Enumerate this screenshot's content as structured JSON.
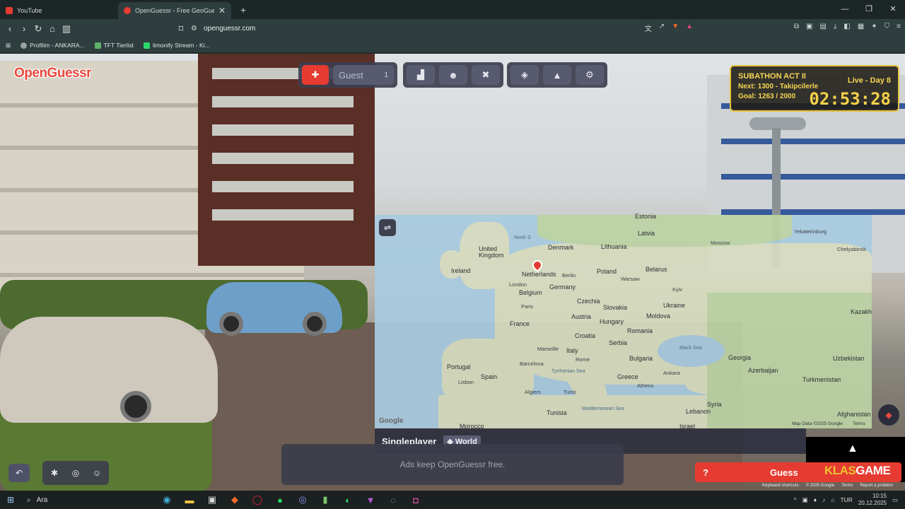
{
  "browser": {
    "tabs": [
      {
        "label": "YouTube",
        "active": false,
        "fav_color": "#e53b31"
      },
      {
        "label": "OpenGuessr - Free GeoGuessr",
        "active": true,
        "fav_color": "#e53b31"
      }
    ],
    "new_tab_icon": "plus-icon",
    "window_controls": [
      "minimize-icon",
      "restore-icon",
      "close-icon"
    ],
    "url": "openguessr.com",
    "bookmarks": [
      {
        "label": "Profilim - ANKARA...",
        "color": "#9aa0a0"
      },
      {
        "label": "TFT Tierlist",
        "color": "#5fb36a"
      },
      {
        "label": "limonify Stream - Ki...",
        "color": "#2bd96b"
      }
    ]
  },
  "game": {
    "logo": "OpenGuessr",
    "guest": {
      "placeholder": "Guest",
      "count": "1"
    },
    "subathon": {
      "title": "SUBATHON ACT II",
      "day": "Live - Day 8",
      "next": "Next: 1300 - Takipcilerle",
      "goal": "Goal: 1263 / 2000",
      "timer": "02:53:28"
    },
    "map": {
      "countries": [
        "United Kingdom",
        "Ireland",
        "Denmark",
        "Netherlands",
        "Belgium",
        "Germany",
        "France",
        "Poland",
        "Lithuania",
        "Latvia",
        "Estonia",
        "Belarus",
        "Czechia",
        "Slovakia",
        "Austria",
        "Hungary",
        "Ukraine",
        "Moldova",
        "Romania",
        "Croatia",
        "Serbia",
        "Bulgaria",
        "Italy",
        "Spain",
        "Portugal",
        "Greece",
        "Georgia",
        "Azerbaijan",
        "Uzbekistan",
        "Turkmenistan",
        "Kazakh",
        "Tunisia",
        "Syria",
        "Lebanon",
        "Israel",
        "Afghanistan",
        "Morocco"
      ],
      "cities": [
        "London",
        "Paris",
        "Berlin",
        "Warsaw",
        "Kyiv",
        "Moscow",
        "Yekaterinburg",
        "Chelyabinsk",
        "Marseille",
        "Barcelona",
        "Rome",
        "Lisbon",
        "Algiers",
        "Tunis",
        "Ankara",
        "Athens"
      ],
      "seas": [
        "North S",
        "Black Sea",
        "Tyrrhenian Sea",
        "Mediterranean Sea"
      ],
      "google": "Google",
      "attribution": [
        "Map Data ©2025 Google",
        "Terms"
      ]
    },
    "mode": "Singleplayer",
    "region": "World",
    "ads": "Ads keep OpenGuessr free.",
    "guess": "Guess",
    "guess_hint": "?",
    "overlay_brand": {
      "a": "KLAS",
      "b": "GAME"
    },
    "footer": [
      "Keyboard shortcuts",
      "© 2025 Google",
      "Terms",
      "Report a problem"
    ]
  },
  "taskbar": {
    "search": "Ara",
    "lang": "TUR",
    "time": "10:15",
    "date": "20.12.2025"
  }
}
